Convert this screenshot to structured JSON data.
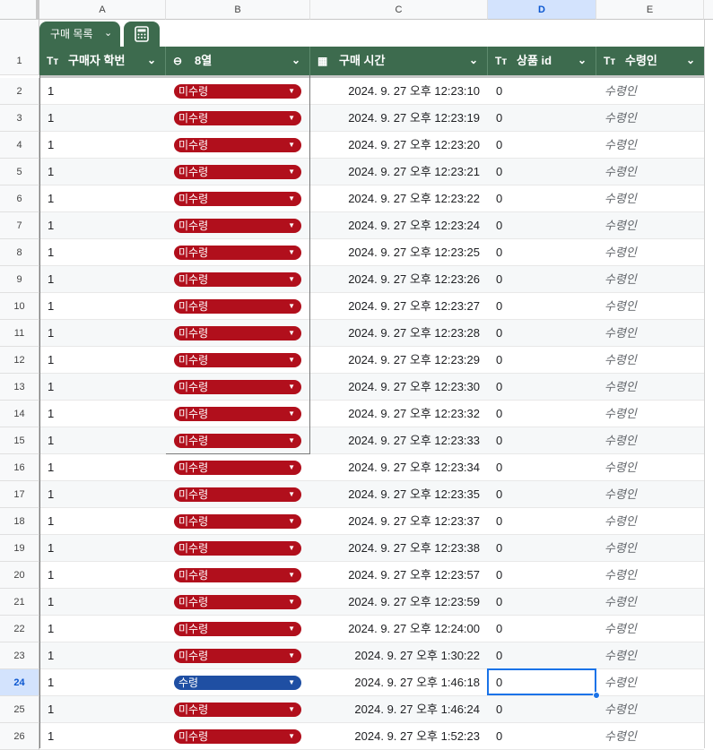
{
  "columns": [
    "A",
    "B",
    "C",
    "D",
    "E"
  ],
  "table_tab": {
    "label": "구매 목록",
    "chevron": "chevron-down-icon",
    "calc_icon": "calculator-icon"
  },
  "headers": [
    {
      "icon": "Tт",
      "label": "구매자 학번"
    },
    {
      "icon": "⊖",
      "label": "8열"
    },
    {
      "icon": "▦",
      "label": "구매 시간"
    },
    {
      "icon": "Tт",
      "label": "상품 id"
    },
    {
      "icon": "Tт",
      "label": "수령인"
    }
  ],
  "header_row_number": "1",
  "colors": {
    "header_green": "#3d6b4e",
    "chip_red": "#b10f1c",
    "chip_blue": "#1f4fa3",
    "selection": "#1a73e8"
  },
  "selected_cell": "D24",
  "rows": [
    {
      "num": "2",
      "a": "1",
      "status": "미수령",
      "time": "2024. 9. 27 오후 12:23:10",
      "d": "0",
      "e": "수령인"
    },
    {
      "num": "3",
      "a": "1",
      "status": "미수령",
      "time": "2024. 9. 27 오후 12:23:19",
      "d": "0",
      "e": "수령인"
    },
    {
      "num": "4",
      "a": "1",
      "status": "미수령",
      "time": "2024. 9. 27 오후 12:23:20",
      "d": "0",
      "e": "수령인"
    },
    {
      "num": "5",
      "a": "1",
      "status": "미수령",
      "time": "2024. 9. 27 오후 12:23:21",
      "d": "0",
      "e": "수령인"
    },
    {
      "num": "6",
      "a": "1",
      "status": "미수령",
      "time": "2024. 9. 27 오후 12:23:22",
      "d": "0",
      "e": "수령인"
    },
    {
      "num": "7",
      "a": "1",
      "status": "미수령",
      "time": "2024. 9. 27 오후 12:23:24",
      "d": "0",
      "e": "수령인"
    },
    {
      "num": "8",
      "a": "1",
      "status": "미수령",
      "time": "2024. 9. 27 오후 12:23:25",
      "d": "0",
      "e": "수령인"
    },
    {
      "num": "9",
      "a": "1",
      "status": "미수령",
      "time": "2024. 9. 27 오후 12:23:26",
      "d": "0",
      "e": "수령인"
    },
    {
      "num": "10",
      "a": "1",
      "status": "미수령",
      "time": "2024. 9. 27 오후 12:23:27",
      "d": "0",
      "e": "수령인"
    },
    {
      "num": "11",
      "a": "1",
      "status": "미수령",
      "time": "2024. 9. 27 오후 12:23:28",
      "d": "0",
      "e": "수령인"
    },
    {
      "num": "12",
      "a": "1",
      "status": "미수령",
      "time": "2024. 9. 27 오후 12:23:29",
      "d": "0",
      "e": "수령인"
    },
    {
      "num": "13",
      "a": "1",
      "status": "미수령",
      "time": "2024. 9. 27 오후 12:23:30",
      "d": "0",
      "e": "수령인"
    },
    {
      "num": "14",
      "a": "1",
      "status": "미수령",
      "time": "2024. 9. 27 오후 12:23:32",
      "d": "0",
      "e": "수령인"
    },
    {
      "num": "15",
      "a": "1",
      "status": "미수령",
      "time": "2024. 9. 27 오후 12:23:33",
      "d": "0",
      "e": "수령인"
    },
    {
      "num": "16",
      "a": "1",
      "status": "미수령",
      "time": "2024. 9. 27 오후 12:23:34",
      "d": "0",
      "e": "수령인"
    },
    {
      "num": "17",
      "a": "1",
      "status": "미수령",
      "time": "2024. 9. 27 오후 12:23:35",
      "d": "0",
      "e": "수령인"
    },
    {
      "num": "18",
      "a": "1",
      "status": "미수령",
      "time": "2024. 9. 27 오후 12:23:37",
      "d": "0",
      "e": "수령인"
    },
    {
      "num": "19",
      "a": "1",
      "status": "미수령",
      "time": "2024. 9. 27 오후 12:23:38",
      "d": "0",
      "e": "수령인"
    },
    {
      "num": "20",
      "a": "1",
      "status": "미수령",
      "time": "2024. 9. 27 오후 12:23:57",
      "d": "0",
      "e": "수령인"
    },
    {
      "num": "21",
      "a": "1",
      "status": "미수령",
      "time": "2024. 9. 27 오후 12:23:59",
      "d": "0",
      "e": "수령인"
    },
    {
      "num": "22",
      "a": "1",
      "status": "미수령",
      "time": "2024. 9. 27 오후 12:24:00",
      "d": "0",
      "e": "수령인"
    },
    {
      "num": "23",
      "a": "1",
      "status": "미수령",
      "time": "2024. 9. 27 오후 1:30:22",
      "d": "0",
      "e": "수령인"
    },
    {
      "num": "24",
      "a": "1",
      "status": "수령",
      "time": "2024. 9. 27 오후 1:46:18",
      "d": "0",
      "e": "수령인"
    },
    {
      "num": "25",
      "a": "1",
      "status": "미수령",
      "time": "2024. 9. 27 오후 1:46:24",
      "d": "0",
      "e": "수령인"
    },
    {
      "num": "26",
      "a": "1",
      "status": "미수령",
      "time": "2024. 9. 27 오후 1:52:23",
      "d": "0",
      "e": "수령인"
    }
  ]
}
